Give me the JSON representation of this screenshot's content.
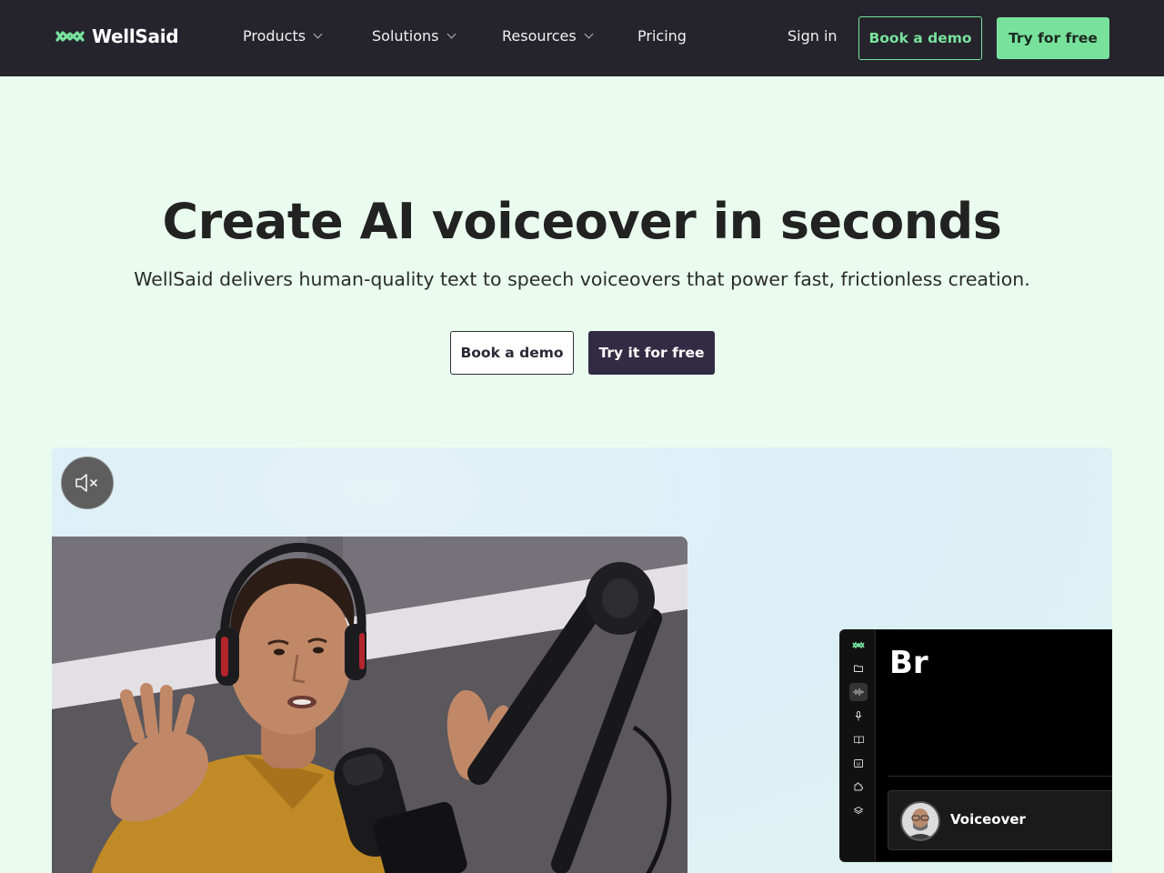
{
  "nav": {
    "brand": "WellSaid",
    "items": [
      {
        "label": "Products",
        "dropdown": true
      },
      {
        "label": "Solutions",
        "dropdown": true
      },
      {
        "label": "Resources",
        "dropdown": true
      },
      {
        "label": "Pricing",
        "dropdown": false
      }
    ],
    "sign_in": "Sign in",
    "book_demo": "Book a demo",
    "try_free": "Try for free"
  },
  "hero": {
    "title": "Create AI voiceover in seconds",
    "subtitle": "WellSaid delivers human-quality text to speech voiceovers that power fast, frictionless creation.",
    "book_demo": "Book a demo",
    "try_free": "Try it for free"
  },
  "media": {
    "mute_icon": "speaker-muted-icon",
    "app_preview": {
      "title": "Br",
      "voice_card_label": "Voiceover",
      "sidebar_icons": [
        "wellsaid-logo-icon",
        "folder-icon",
        "waveform-icon",
        "microphone-icon",
        "book-icon",
        "caption-icon",
        "puzzle-icon",
        "layers-icon"
      ]
    }
  },
  "colors": {
    "nav_bg": "#25242c",
    "accent_green": "#78e29d",
    "hero_bg": "#e9fcef",
    "primary_dark": "#332a44"
  }
}
